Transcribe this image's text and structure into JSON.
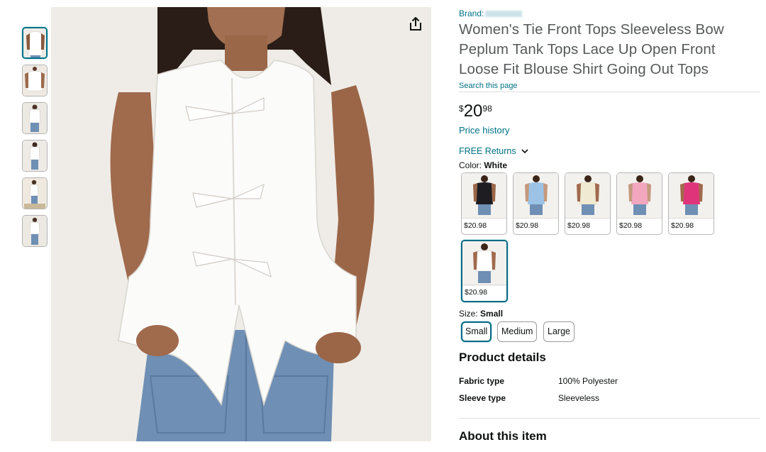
{
  "thumbnails": [
    "thumb-1",
    "thumb-2",
    "thumb-3",
    "thumb-4",
    "thumb-5",
    "thumb-6"
  ],
  "product": {
    "brand_label": "Brand:",
    "title": "Women's Tie Front Tops Sleeveless Bow Peplum Tank Tops Lace Up Open Front Loose Fit Blouse Shirt Going Out Tops",
    "search_link": "Search this page",
    "price": {
      "symbol": "$",
      "whole": "20",
      "fraction": "98"
    },
    "price_history": "Price history",
    "returns": "FREE Returns",
    "color_label": "Color:",
    "color_value": "White",
    "colors": [
      {
        "name": "Black",
        "price": "$20.98",
        "hex": "#1e1e22"
      },
      {
        "name": "Light Blue",
        "price": "$20.98",
        "hex": "#9cc3e6"
      },
      {
        "name": "Beige",
        "price": "$20.98",
        "hex": "#f1ead2"
      },
      {
        "name": "Pink",
        "price": "$20.98",
        "hex": "#f2a7bf"
      },
      {
        "name": "Rose",
        "price": "$20.98",
        "hex": "#e0347a"
      },
      {
        "name": "White",
        "price": "$20.98",
        "hex": "#f7f7f7"
      }
    ],
    "size_label": "Size:",
    "size_value": "Small",
    "sizes": [
      "Small",
      "Medium",
      "Large"
    ],
    "details_heading": "Product details",
    "details": [
      {
        "label": "Fabric type",
        "value": "100% Polyester"
      },
      {
        "label": "Sleeve type",
        "value": "Sleeveless"
      }
    ],
    "about_heading": "About this item"
  },
  "icons": {
    "share": "share-icon",
    "returns_chevron": "chevron-down-icon"
  },
  "colors": {
    "link": "#007185",
    "selected_border": "#0a6a84",
    "title_gray": "#565959"
  }
}
